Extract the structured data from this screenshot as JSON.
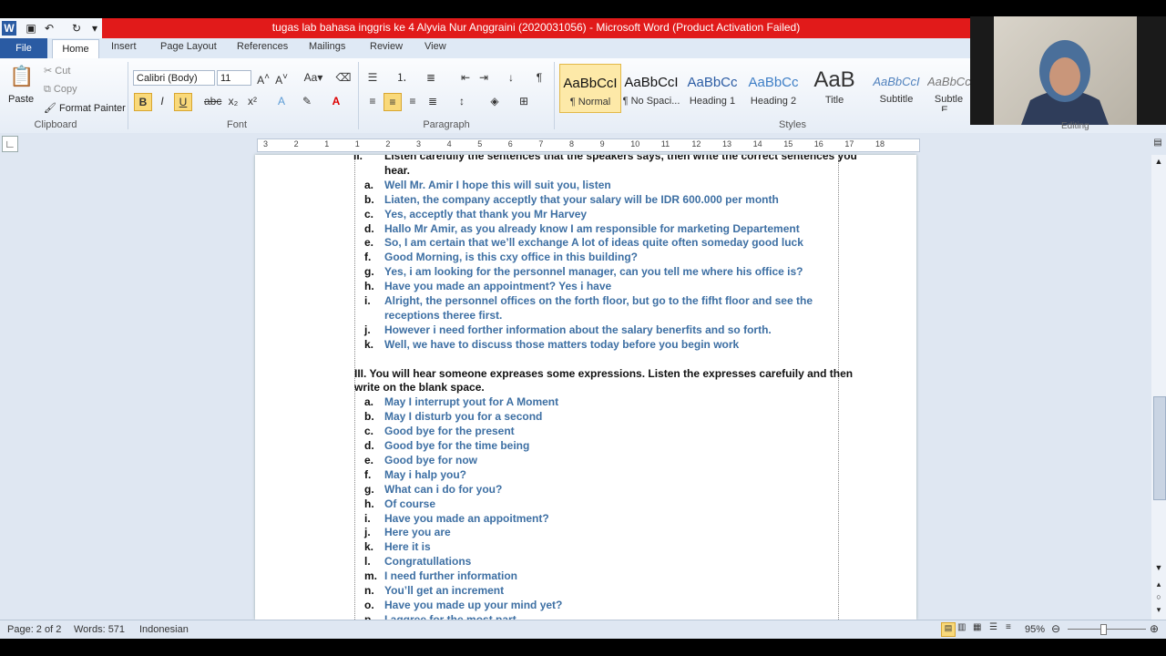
{
  "window": {
    "title": "tugas lab bahasa inggris ke 4 Alyvia Nur Anggraini (2020031056)  -  Microsoft Word (Product Activation Failed)"
  },
  "tabs": [
    "File",
    "Home",
    "Insert",
    "Page Layout",
    "References",
    "Mailings",
    "Review",
    "View"
  ],
  "clipboard": {
    "paste": "Paste",
    "cut": "Cut",
    "copy": "Copy",
    "format_painter": "Format Painter",
    "label": "Clipboard"
  },
  "font": {
    "name": "Calibri (Body)",
    "size": "11",
    "label": "Font"
  },
  "paragraph": {
    "label": "Paragraph"
  },
  "styles": {
    "label": "Styles",
    "items": [
      {
        "sample": "AaBbCcI",
        "name": "¶ Normal"
      },
      {
        "sample": "AaBbCcI",
        "name": "¶ No Spaci..."
      },
      {
        "sample": "AaBbCc",
        "name": "Heading 1"
      },
      {
        "sample": "AaBbCc",
        "name": "Heading 2"
      },
      {
        "sample": "AaB",
        "name": "Title"
      },
      {
        "sample": "AaBbCcI",
        "name": "Subtitle"
      },
      {
        "sample": "AaBbCc",
        "name": "Subtle E..."
      }
    ]
  },
  "editing": {
    "label": "Editing"
  },
  "ruler": {
    "ticks": [
      "3",
      "2",
      "1",
      "1",
      "2",
      "3",
      "4",
      "5",
      "6",
      "7",
      "8",
      "9",
      "10",
      "11",
      "12",
      "13",
      "14",
      "15",
      "16",
      "17",
      "18"
    ]
  },
  "document": {
    "section2_lines": [
      {
        "marker": "II.",
        "text": "Listen carefully the sentences that the speakers says, then write the correct sentences you"
      },
      {
        "marker": "",
        "text": "hear."
      }
    ],
    "section2_items": [
      {
        "marker": "a.",
        "text": "Well Mr. Amir I hope this will suit you, listen"
      },
      {
        "marker": "b.",
        "text": "Liaten, the company acceptly that your salary will be IDR 600.000 per month"
      },
      {
        "marker": "c.",
        "text": "Yes, acceptly that thank you Mr Harvey"
      },
      {
        "marker": "d.",
        "text": "Hallo Mr Amir, as you already know I am responsible for marketing Departement"
      },
      {
        "marker": "e.",
        "text": "So, I am certain that we’ll exchange A lot of ideas quite often someday good luck"
      },
      {
        "marker": "f.",
        "text": "Good Morning, is this cxy office in this building?"
      },
      {
        "marker": "g.",
        "text": "Yes, i am looking for the personnel manager, can you tell me where his office is?"
      },
      {
        "marker": "h.",
        "text": "Have you made an appointment? Yes i have"
      },
      {
        "marker": "i.",
        "text": "Alright, the personnel offices on the forth floor, but go to the fifht floor and see the"
      },
      {
        "marker": "",
        "text": "receptions theree first."
      },
      {
        "marker": "j.",
        "text": "However i need forther information about the salary benerfits and so forth."
      },
      {
        "marker": "k.",
        "text": "Well, we have to discuss those matters today before you begin work"
      }
    ],
    "section3_heading": [
      "III. You will hear someone expreases some expressions. Listen the expresses carefuily and then",
      "write on the blank space."
    ],
    "section3_items": [
      {
        "marker": "a.",
        "text": "May I  interrupt yout for A Moment"
      },
      {
        "marker": "b.",
        "text": "May I disturb you for a second"
      },
      {
        "marker": "c.",
        "text": "Good bye for the present"
      },
      {
        "marker": "d.",
        "text": "Good bye for the time being"
      },
      {
        "marker": "e.",
        "text": "Good bye for now"
      },
      {
        "marker": "f.",
        "text": "May i halp you?"
      },
      {
        "marker": "g.",
        "text": "What can i do for you?"
      },
      {
        "marker": "h.",
        "text": "Of course"
      },
      {
        "marker": "i.",
        "text": "Have you made an appoitment?"
      },
      {
        "marker": "j.",
        "text": "Here you are"
      },
      {
        "marker": "k.",
        "text": "Here it is"
      },
      {
        "marker": "l.",
        "text": "Congratullations"
      },
      {
        "marker": "m.",
        "text": "I need further information"
      },
      {
        "marker": "n.",
        "text": "You’ll get an increment"
      },
      {
        "marker": "o.",
        "text": "Have you made up your mind yet?"
      },
      {
        "marker": "p.",
        "text": "I aggree for the most part"
      }
    ]
  },
  "status": {
    "page": "Page: 2 of 2",
    "words": "Words: 571",
    "language": "Indonesian",
    "zoom": "95%"
  },
  "colors": {
    "title_bar": "#e11a1a",
    "file_tab": "#2a5ba3",
    "body_text_blue": "#3d6fa3"
  }
}
